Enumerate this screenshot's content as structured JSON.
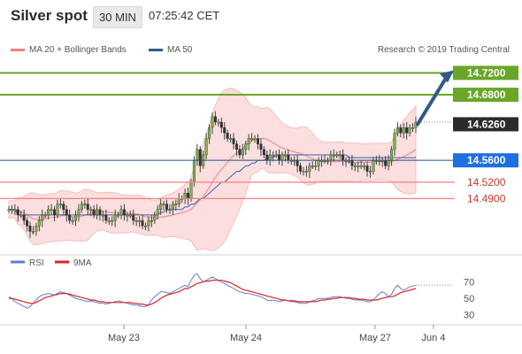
{
  "header": {
    "title": "Silver spot",
    "timeframe": "30 MIN",
    "time": "07:25:42 CET"
  },
  "legend": {
    "ma_bb_label": "MA 20 + Bollinger Bands",
    "ma50_label": "MA 50",
    "ma_bb_color": "#f08080",
    "ma50_color": "#2e5a8a",
    "credit": "Research © 2019 Trading Central"
  },
  "chart_data": [
    {
      "type": "candlestick",
      "title": "Silver spot",
      "x_ticks": [
        "May 23",
        "May 24",
        "May 27",
        "Jun 4"
      ],
      "y_range": [
        14.4,
        14.74
      ],
      "price_levels": [
        {
          "label": "14.7200",
          "value": 14.72,
          "style": "resistance",
          "color": "#6aa62a"
        },
        {
          "label": "14.6800",
          "value": 14.68,
          "style": "resistance",
          "color": "#6aa62a"
        },
        {
          "label": "14.6260",
          "value": 14.626,
          "style": "last-price",
          "color": "#2b2b2b"
        },
        {
          "label": "14.5600",
          "value": 14.56,
          "style": "pivot",
          "color": "#1e6fe0"
        },
        {
          "label": "14.5200",
          "value": 14.52,
          "style": "support",
          "color": "#f08080"
        },
        {
          "label": "14.4900",
          "value": 14.49,
          "style": "support",
          "color": "#f08080"
        }
      ],
      "arrow": {
        "from": 14.626,
        "to": 14.72,
        "color": "#2e5a8a"
      },
      "closes": [
        14.47,
        14.47,
        14.47,
        14.46,
        14.46,
        14.45,
        14.44,
        14.43,
        14.43,
        14.44,
        14.45,
        14.46,
        14.46,
        14.47,
        14.47,
        14.46,
        14.48,
        14.48,
        14.47,
        14.46,
        14.45,
        14.45,
        14.46,
        14.47,
        14.48,
        14.48,
        14.47,
        14.47,
        14.46,
        14.47,
        14.46,
        14.46,
        14.45,
        14.45,
        14.45,
        14.46,
        14.46,
        14.47,
        14.46,
        14.46,
        14.46,
        14.45,
        14.45,
        14.45,
        14.44,
        14.44,
        14.45,
        14.45,
        14.46,
        14.47,
        14.48,
        14.48,
        14.47,
        14.47,
        14.48,
        14.48,
        14.49,
        14.49,
        14.5,
        14.49,
        14.52,
        14.56,
        14.58,
        14.55,
        14.57,
        14.6,
        14.62,
        14.64,
        14.63,
        14.63,
        14.62,
        14.61,
        14.6,
        14.6,
        14.59,
        14.58,
        14.57,
        14.58,
        14.59,
        14.6,
        14.6,
        14.6,
        14.59,
        14.58,
        14.57,
        14.56,
        14.57,
        14.57,
        14.57,
        14.56,
        14.57,
        14.57,
        14.56,
        14.56,
        14.56,
        14.55,
        14.54,
        14.54,
        14.54,
        14.55,
        14.55,
        14.55,
        14.56,
        14.56,
        14.56,
        14.56,
        14.57,
        14.57,
        14.57,
        14.57,
        14.56,
        14.56,
        14.56,
        14.55,
        14.55,
        14.55,
        14.55,
        14.55,
        14.54,
        14.54,
        14.56,
        14.56,
        14.56,
        14.56,
        14.55,
        14.56,
        14.58,
        14.61,
        14.62,
        14.61,
        14.62,
        14.61,
        14.62,
        14.62,
        14.63
      ],
      "ma50": [
        14.47,
        14.47,
        14.47,
        14.46,
        14.46,
        14.46,
        14.46,
        14.46,
        14.46,
        14.46,
        14.46,
        14.46,
        14.46,
        14.46,
        14.46,
        14.46,
        14.46,
        14.46,
        14.46,
        14.46,
        14.46,
        14.46,
        14.46,
        14.46,
        14.46,
        14.46,
        14.46,
        14.46,
        14.46,
        14.46,
        14.46,
        14.46,
        14.46,
        14.46,
        14.46,
        14.46,
        14.46,
        14.46,
        14.46,
        14.46,
        14.46,
        14.46,
        14.46,
        14.46,
        14.46,
        14.46,
        14.46,
        14.46,
        14.46,
        14.46,
        14.465,
        14.465,
        14.47,
        14.47,
        14.47,
        14.47,
        14.47,
        14.47,
        14.475,
        14.475,
        14.48,
        14.48,
        14.485,
        14.49,
        14.49,
        14.495,
        14.5,
        14.505,
        14.51,
        14.515,
        14.52,
        14.52,
        14.525,
        14.53,
        14.535,
        14.54,
        14.54,
        14.545,
        14.55,
        14.55,
        14.555,
        14.555,
        14.56,
        14.56,
        14.56,
        14.565,
        14.565,
        14.565,
        14.57,
        14.57,
        14.57,
        14.57,
        14.57,
        14.57,
        14.57,
        14.57,
        14.57,
        14.57,
        14.57,
        14.57,
        14.57,
        14.57,
        14.57,
        14.57,
        14.57,
        14.57,
        14.57,
        14.57,
        14.57,
        14.57,
        14.57,
        14.57,
        14.565,
        14.565,
        14.565,
        14.565,
        14.565,
        14.565,
        14.565,
        14.565,
        14.565,
        14.565,
        14.565,
        14.565,
        14.565,
        14.565,
        14.565,
        14.565,
        14.565,
        14.565,
        14.565,
        14.565,
        14.565,
        14.565,
        14.565
      ]
    },
    {
      "type": "line",
      "legend": [
        {
          "name": "RSI",
          "color": "#5b7fd6"
        },
        {
          "name": "9MA",
          "color": "#e02020"
        }
      ],
      "ylim": [
        20,
        90
      ],
      "y_ticks": [
        70,
        50,
        30
      ],
      "rsi": [
        52,
        50,
        46,
        44,
        42,
        40,
        38,
        40,
        44,
        48,
        52,
        54,
        55,
        56,
        55,
        54,
        56,
        58,
        57,
        56,
        54,
        52,
        50,
        49,
        48,
        47,
        46,
        47,
        46,
        45,
        44,
        44,
        43,
        44,
        45,
        46,
        47,
        46,
        45,
        44,
        43,
        42,
        42,
        41,
        40,
        40,
        42,
        48,
        52,
        55,
        58,
        58,
        57,
        56,
        58,
        60,
        62,
        64,
        66,
        64,
        72,
        78,
        80,
        74,
        70,
        72,
        74,
        76,
        74,
        72,
        70,
        68,
        66,
        64,
        62,
        60,
        58,
        57,
        56,
        56,
        55,
        54,
        53,
        52,
        50,
        48,
        47,
        48,
        47,
        46,
        47,
        48,
        47,
        46,
        46,
        45,
        44,
        44,
        44,
        46,
        47,
        48,
        50,
        50,
        50,
        50,
        51,
        52,
        52,
        52,
        51,
        50,
        50,
        49,
        48,
        48,
        48,
        47,
        46,
        46,
        48,
        52,
        56,
        58,
        56,
        52,
        55,
        62,
        66,
        62,
        60,
        62,
        64,
        65,
        66
      ],
      "ma9": [
        50,
        50,
        49,
        48,
        47,
        46,
        45,
        44,
        44,
        45,
        47,
        49,
        51,
        52,
        53,
        54,
        55,
        56,
        56,
        56,
        55,
        54,
        53,
        52,
        51,
        50,
        49,
        48,
        48,
        47,
        46,
        46,
        45,
        45,
        45,
        45,
        45,
        45,
        45,
        45,
        45,
        44,
        44,
        43,
        43,
        42,
        42,
        43,
        45,
        47,
        50,
        52,
        54,
        55,
        56,
        57,
        58,
        60,
        62,
        62,
        64,
        66,
        68,
        69,
        70,
        71,
        71,
        72,
        72,
        72,
        72,
        71,
        70,
        69,
        67,
        65,
        63,
        61,
        60,
        59,
        58,
        57,
        56,
        55,
        54,
        53,
        52,
        51,
        50,
        49,
        48,
        48,
        47,
        47,
        47,
        46,
        46,
        46,
        46,
        46,
        46,
        46,
        47,
        48,
        48,
        49,
        49,
        50,
        50,
        51,
        51,
        51,
        51,
        50,
        50,
        49,
        49,
        49,
        48,
        48,
        48,
        48,
        49,
        50,
        51,
        52,
        52,
        53,
        55,
        57,
        58,
        59,
        60,
        61,
        62
      ]
    }
  ]
}
